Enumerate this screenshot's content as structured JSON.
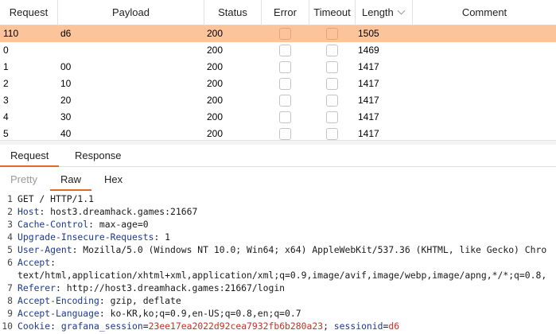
{
  "table": {
    "columns": {
      "request": "Request",
      "payload": "Payload",
      "status": "Status",
      "error": "Error",
      "timeout": "Timeout",
      "length": "Length",
      "comment": "Comment"
    },
    "sorted_column": "length",
    "rows": [
      {
        "request": "110",
        "payload": "d6",
        "status": "200",
        "error": false,
        "timeout": false,
        "length": "1505",
        "comment": "",
        "selected": true
      },
      {
        "request": "0",
        "payload": "",
        "status": "200",
        "error": false,
        "timeout": false,
        "length": "1469",
        "comment": "",
        "selected": false
      },
      {
        "request": "1",
        "payload": "00",
        "status": "200",
        "error": false,
        "timeout": false,
        "length": "1417",
        "comment": "",
        "selected": false
      },
      {
        "request": "2",
        "payload": "10",
        "status": "200",
        "error": false,
        "timeout": false,
        "length": "1417",
        "comment": "",
        "selected": false
      },
      {
        "request": "3",
        "payload": "20",
        "status": "200",
        "error": false,
        "timeout": false,
        "length": "1417",
        "comment": "",
        "selected": false
      },
      {
        "request": "4",
        "payload": "30",
        "status": "200",
        "error": false,
        "timeout": false,
        "length": "1417",
        "comment": "",
        "selected": false
      },
      {
        "request": "5",
        "payload": "40",
        "status": "200",
        "error": false,
        "timeout": false,
        "length": "1417",
        "comment": "",
        "selected": false
      }
    ]
  },
  "message_tabs": {
    "request": "Request",
    "response": "Response",
    "active": "request"
  },
  "view_tabs": {
    "pretty": "Pretty",
    "raw": "Raw",
    "hex": "Hex",
    "active": "raw"
  },
  "raw_lines": [
    {
      "n": "1",
      "parts": [
        {
          "t": "GET / HTTP/1.1",
          "c": "plain"
        }
      ]
    },
    {
      "n": "2",
      "parts": [
        {
          "t": "Host",
          "c": "hk"
        },
        {
          "t": ": host3.dreamhack.games:21667",
          "c": "plain"
        }
      ]
    },
    {
      "n": "3",
      "parts": [
        {
          "t": "Cache-Control",
          "c": "hk"
        },
        {
          "t": ": max-age=0",
          "c": "plain"
        }
      ]
    },
    {
      "n": "4",
      "parts": [
        {
          "t": "Upgrade-Insecure-Requests",
          "c": "hk"
        },
        {
          "t": ": 1",
          "c": "plain"
        }
      ]
    },
    {
      "n": "5",
      "parts": [
        {
          "t": "User-Agent",
          "c": "hk"
        },
        {
          "t": ": Mozilla/5.0 (Windows NT 10.0; Win64; x64) AppleWebKit/537.36 (KHTML, like Gecko) Chro",
          "c": "plain"
        }
      ]
    },
    {
      "n": "6",
      "parts": [
        {
          "t": "Accept",
          "c": "hk"
        },
        {
          "t": ":",
          "c": "plain"
        }
      ]
    },
    {
      "n": "",
      "parts": [
        {
          "t": "text/html,application/xhtml+xml,application/xml;q=0.9,image/avif,image/webp,image/apng,*/*;q=0.8,",
          "c": "plain"
        }
      ]
    },
    {
      "n": "7",
      "parts": [
        {
          "t": "Referer",
          "c": "hk"
        },
        {
          "t": ": http://host3.dreamhack.games:21667/login",
          "c": "plain"
        }
      ]
    },
    {
      "n": "8",
      "parts": [
        {
          "t": "Accept-Encoding",
          "c": "hk"
        },
        {
          "t": ": gzip, deflate",
          "c": "plain"
        }
      ]
    },
    {
      "n": "9",
      "parts": [
        {
          "t": "Accept-Language",
          "c": "hk"
        },
        {
          "t": ": ko-KR,ko;q=0.9,en-US;q=0.8,en;q=0.7",
          "c": "plain"
        }
      ]
    },
    {
      "n": "10",
      "parts": [
        {
          "t": "Cookie",
          "c": "hk"
        },
        {
          "t": ": ",
          "c": "plain"
        },
        {
          "t": "grafana_session",
          "c": "ck"
        },
        {
          "t": "=",
          "c": "plain"
        },
        {
          "t": "23ee17ea2022d92cea7932fb6b280a23",
          "c": "cv"
        },
        {
          "t": "; ",
          "c": "plain"
        },
        {
          "t": "sessionid",
          "c": "ck"
        },
        {
          "t": "=",
          "c": "plain"
        },
        {
          "t": "d6",
          "c": "cv"
        }
      ]
    }
  ],
  "colors": {
    "selected_row": "#fcc49a",
    "active_tab_underline": "#e06a2a",
    "header_key": "#1e3a8a",
    "cookie_value": "#c0322b"
  }
}
